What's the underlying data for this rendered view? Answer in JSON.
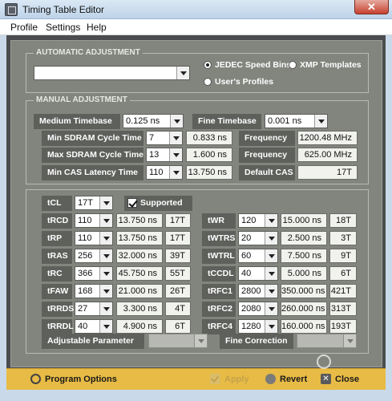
{
  "window": {
    "title": "Timing Table Editor",
    "close_symbol": "✕"
  },
  "menu": [
    "Profile",
    "Settings",
    "Help"
  ],
  "automatic": {
    "title": "AUTOMATIC ADJUSTMENT",
    "profile_value": "",
    "radio_jedec": "JEDEC Speed Bins",
    "radio_xmp": "XMP Templates",
    "radio_user": "User's Profiles"
  },
  "manual": {
    "title": "MANUAL ADJUSTMENT",
    "medium_timebase": {
      "label": "Medium Timebase",
      "value": "0.125 ns"
    },
    "fine_timebase": {
      "label": "Fine Timebase",
      "value": "0.001 ns"
    },
    "min_cycle": {
      "label": "Min SDRAM Cycle Time",
      "value": "7",
      "ns": "0.833 ns"
    },
    "max_cycle": {
      "label": "Max SDRAM Cycle Time",
      "value": "13",
      "ns": "1.600 ns"
    },
    "min_cas": {
      "label": "Min CAS Latency Time",
      "value": "110",
      "ns": "13.750 ns"
    },
    "freq1": {
      "label": "Frequency",
      "value": "1200.48 MHz"
    },
    "freq2": {
      "label": "Frequency",
      "value": "625.00 MHz"
    },
    "default_cas": {
      "label": "Default CAS",
      "value": "17T"
    }
  },
  "timings": {
    "tcl": {
      "label": "tCL",
      "value": "17T",
      "supported": "Supported"
    },
    "left": [
      {
        "label": "tRCD",
        "value": "110",
        "ns": "13.750 ns",
        "t": "17T"
      },
      {
        "label": "tRP",
        "value": "110",
        "ns": "13.750 ns",
        "t": "17T"
      },
      {
        "label": "tRAS",
        "value": "256",
        "ns": "32.000 ns",
        "t": "39T"
      },
      {
        "label": "tRC",
        "value": "366",
        "ns": "45.750 ns",
        "t": "55T"
      },
      {
        "label": "tFAW",
        "value": "168",
        "ns": "21.000 ns",
        "t": "26T"
      },
      {
        "label": "tRRDS",
        "value": "27",
        "ns": "3.300 ns",
        "t": "4T"
      },
      {
        "label": "tRRDL",
        "value": "40",
        "ns": "4.900 ns",
        "t": "6T"
      }
    ],
    "right": [
      {
        "label": "tWR",
        "value": "120",
        "ns": "15.000 ns",
        "t": "18T"
      },
      {
        "label": "tWTRS",
        "value": "20",
        "ns": "2.500 ns",
        "t": "3T"
      },
      {
        "label": "tWTRL",
        "value": "60",
        "ns": "7.500 ns",
        "t": "9T"
      },
      {
        "label": "tCCDL",
        "value": "40",
        "ns": "5.000 ns",
        "t": "6T"
      },
      {
        "label": "tRFC1",
        "value": "2800",
        "ns": "350.000 ns",
        "t": "421T"
      },
      {
        "label": "tRFC2",
        "value": "2080",
        "ns": "260.000 ns",
        "t": "313T"
      },
      {
        "label": "tRFC4",
        "value": "1280",
        "ns": "160.000 ns",
        "t": "193T"
      }
    ],
    "adjustable": {
      "label": "Adjustable Parameter",
      "value": ""
    },
    "fine_correction": {
      "label": "Fine Correction",
      "value": ""
    }
  },
  "bottom": {
    "program_options": "Program Options",
    "apply": "Apply",
    "revert": "Revert",
    "close": "Close",
    "close_symbol": "✕"
  }
}
